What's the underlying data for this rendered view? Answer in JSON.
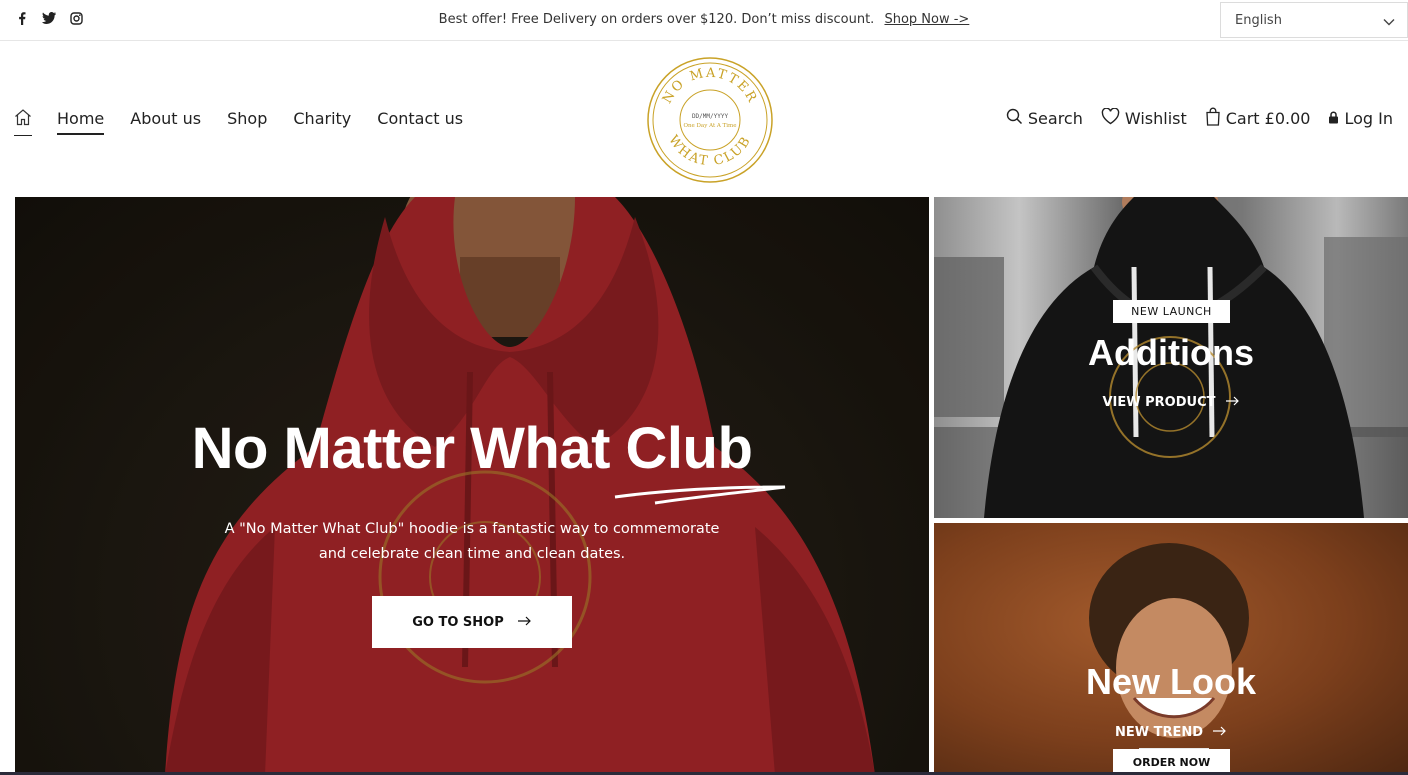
{
  "topbar": {
    "social_icons": [
      "facebook-icon",
      "twitter-icon",
      "instagram-icon"
    ],
    "announcement": "Best offer! Free Delivery on orders over $120. Don’t miss discount.",
    "shop_link": "Shop Now ->",
    "language": "English"
  },
  "nav": {
    "items": [
      {
        "label": "Home",
        "active": true
      },
      {
        "label": "About us",
        "active": false
      },
      {
        "label": "Shop",
        "active": false
      },
      {
        "label": "Charity",
        "active": false
      },
      {
        "label": "Contact us",
        "active": false
      }
    ]
  },
  "logo": {
    "top_text": "NO MATTER",
    "bottom_text": "WHAT CLUB",
    "date_text": "DD/MM/YYYY",
    "motto": "One Day At A Time",
    "accent": "#c9a227"
  },
  "header_actions": {
    "search": "Search",
    "wishlist": "Wishlist",
    "cart": "Cart £0.00",
    "login": "Log In"
  },
  "hero": {
    "title": "No Matter What Club",
    "description_line1": "A \"No Matter What Club\" hoodie is a fantastic way to commemorate",
    "description_line2": "and celebrate clean time and clean dates.",
    "button": "GO TO SHOP"
  },
  "promo_top": {
    "badge": "NEW LAUNCH",
    "title": "Additions",
    "link": "VIEW PRODUCT"
  },
  "promo_bottom": {
    "title": "New Look",
    "link": "NEW TREND",
    "button": "ORDER NOW"
  },
  "colors": {
    "hoodie_red": "#a8262a",
    "gold": "#c9a227",
    "text_dark": "#222222"
  }
}
